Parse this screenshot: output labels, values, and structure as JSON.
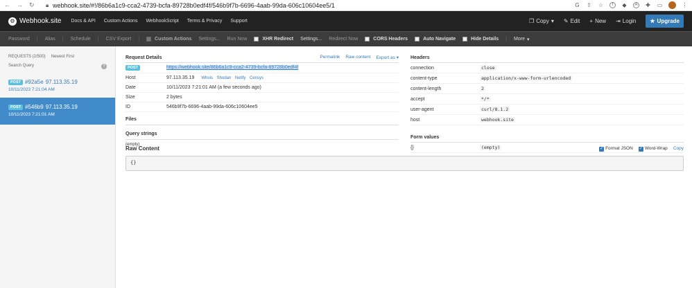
{
  "browser": {
    "url": "webhook.site/#!/86b6a1c9-cca2-4739-bcfa-89728b0edf4f/546b9f7b-6696-4aab-99da-606c10604ee5/1"
  },
  "nav": {
    "brand": "Webhook.site",
    "links": [
      "Docs & API",
      "Custom Actions",
      "WebhookScript",
      "Terms & Privacy",
      "Support"
    ],
    "copy": "Copy",
    "edit": "Edit",
    "new": "New",
    "login": "Login",
    "upgrade": "Upgrade"
  },
  "toolbar": {
    "password": "Password",
    "alias": "Alias",
    "schedule": "Schedule",
    "csv": "CSV Export",
    "custom_actions": "Custom Actions",
    "settings1": "Settings...",
    "run_now": "Run Now",
    "xhr": "XHR Redirect",
    "settings2": "Settings...",
    "redirect_now": "Redirect Now",
    "cors": "CORS Headers",
    "auto_nav": "Auto Navigate",
    "hide_details": "Hide Details",
    "more": "More"
  },
  "sidebar": {
    "requests_label": "REQUESTS (2/500)",
    "sort_label": "Newest First",
    "search_label": "Search Query",
    "requests": [
      {
        "method": "POST",
        "id": "#92a5e",
        "ip": "97.113.35.19",
        "time": "10/11/2023 7:21:04 AM"
      },
      {
        "method": "POST",
        "id": "#546b9",
        "ip": "97.113.35.19",
        "time": "10/11/2023 7:21:01 AM"
      }
    ]
  },
  "details": {
    "title": "Request Details",
    "permalink": "Permalink",
    "raw_content_link": "Raw content",
    "export": "Export as",
    "method": "POST",
    "url": "https://webhook.site/86b6a1c9-cca2-4739-bcfa-89728b0edf4f",
    "host_label": "Host",
    "host": "97.113.35.19",
    "host_links": [
      "Whois",
      "Shodan",
      "Netify",
      "Censys"
    ],
    "date_label": "Date",
    "date": "10/11/2023 7:21:01 AM (a few seconds ago)",
    "size_label": "Size",
    "size": "2 bytes",
    "id_label": "ID",
    "id": "546b9f7b-6696-4aab-99da-606c10604ee5",
    "files_title": "Files",
    "query_title": "Query strings",
    "query_empty": "(empty)"
  },
  "headers": {
    "title": "Headers",
    "rows": [
      {
        "k": "connection",
        "v": "close"
      },
      {
        "k": "content-type",
        "v": "application/x-www-form-urlencoded"
      },
      {
        "k": "content-length",
        "v": "2"
      },
      {
        "k": "accept",
        "v": "*/*"
      },
      {
        "k": "user-agent",
        "v": "curl/8.1.2"
      },
      {
        "k": "host",
        "v": "webhook.site"
      }
    ],
    "form_title": "Form values",
    "form_key": "{}",
    "form_value": "(empty)"
  },
  "raw": {
    "title": "Raw Content",
    "format_json": "Format JSON",
    "word_wrap": "Word-Wrap",
    "copy": "Copy",
    "content": "{}"
  }
}
